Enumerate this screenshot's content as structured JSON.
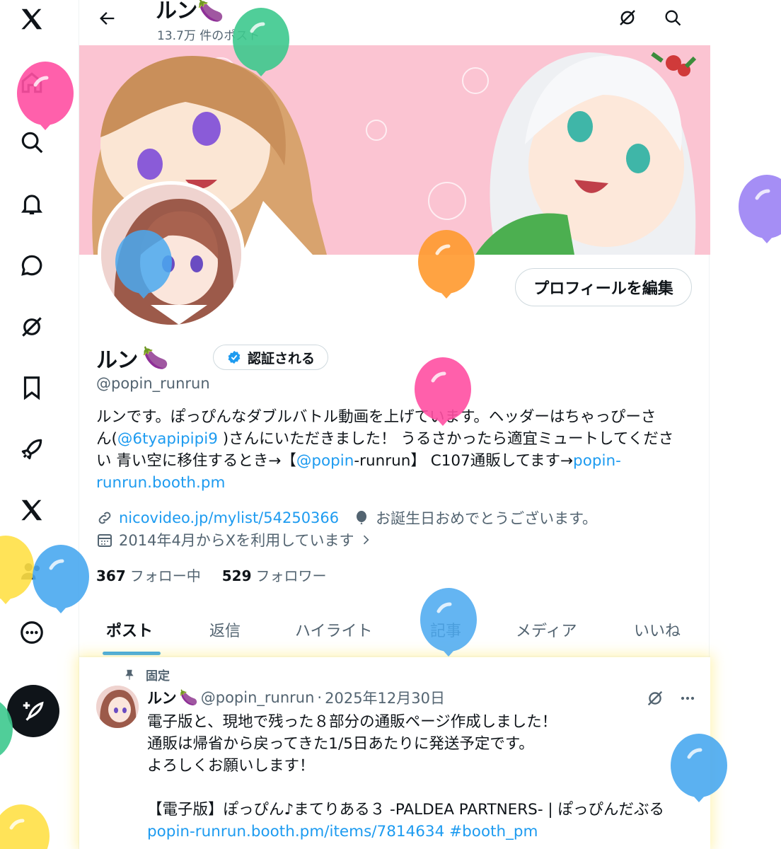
{
  "header": {
    "title": "ルン",
    "post_count": "13.7万 件のポスト"
  },
  "profile": {
    "display_name": "ルン",
    "verify_label": "認証される",
    "handle": "@popin_runrun",
    "edit_button": "プロフィールを編集",
    "bio": {
      "line1": "ルンです。ぽっぴんなダブルバトル動画を上げています。ヘッダーはちゃっぴーさ",
      "line2_pre": "ん(",
      "line2_link": "@6tyapipipi9",
      "line2_post": " )さんにいただきました！ うるさかったら適宜ミュートしてくださ",
      "line3_pre": "い 青い空に移住するとき→【",
      "line3_link": "@popin",
      "line3_mid": "-runrun】 C107通販してます→",
      "line3_link2": "popin-",
      "line4_link": "runrun.booth.pm"
    },
    "website": "nicovideo.jp/mylist/54250366",
    "birthday": "お誕生日おめでとうございます。",
    "joined": "2014年4月からXを利用しています",
    "following_count": "367",
    "following_label": "フォロー中",
    "followers_count": "529",
    "followers_label": "フォロワー"
  },
  "tabs": [
    {
      "label": "ポスト",
      "active": true
    },
    {
      "label": "返信"
    },
    {
      "label": "ハイライト"
    },
    {
      "label": "記事"
    },
    {
      "label": "メディア"
    },
    {
      "label": "いいね"
    }
  ],
  "pinned_post": {
    "pinned_label": "固定",
    "author": "ルン",
    "handle": "@popin_runrun",
    "separator": "·",
    "date": "2025年12月30日",
    "lines": [
      "電子版と、現地で残った８部分の通販ページ作成しました！",
      "通販は帰省から戻ってきた1/5日あたりに発送予定です。",
      "よろしくお願いします！",
      "",
      "【電子版】ぽっぴん♪まてりある３ -PALDEA PARTNERS- | ぽっぴんだぶる"
    ],
    "link": "popin-runrun.booth.pm/items/7814634",
    "hashtag": "#booth_pm"
  },
  "nav": {
    "items": [
      "x-logo-icon",
      "home-icon",
      "explore-icon",
      "notifications-icon",
      "messages-icon",
      "grok-icon",
      "bookmarks-icon",
      "communities-icon",
      "premium-icon",
      "profile-icon",
      "more-icon",
      "compose-icon"
    ]
  },
  "colors": {
    "link": "#1d9bf0",
    "banner_bg": "#fbc4d2",
    "secondary_text": "#536471",
    "balloon_pink": "#ff4fa3",
    "balloon_green": "#3ec98e",
    "balloon_blue": "#4aa9f0",
    "balloon_orange": "#ff9a2e",
    "balloon_purple": "#9c82f5",
    "balloon_yellow": "#ffe046"
  }
}
